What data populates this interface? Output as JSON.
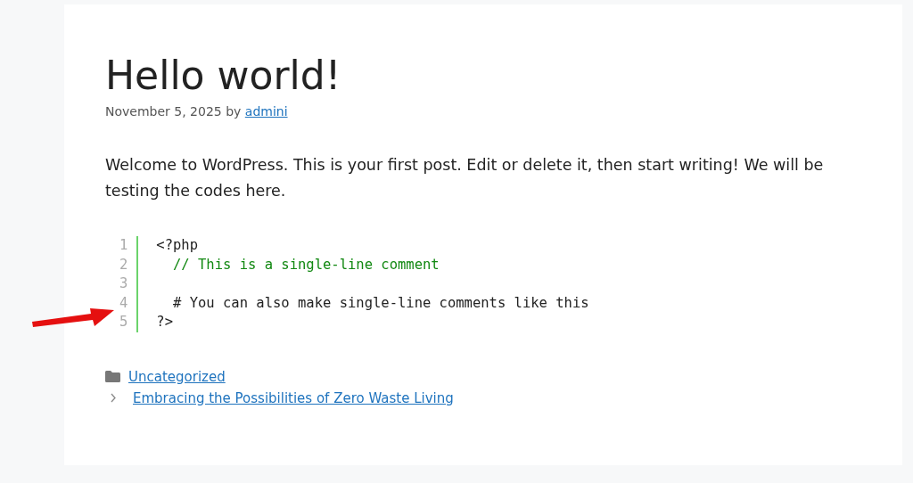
{
  "post": {
    "title": "Hello world!",
    "meta": {
      "date": "November 5, 2025",
      "by": "by",
      "author": "admini"
    },
    "body": "Welcome to WordPress. This is your first post. Edit or delete it, then start writing! We will be testing the codes here.",
    "code": [
      {
        "number": "1",
        "kind": "code",
        "text": "<?php"
      },
      {
        "number": "2",
        "kind": "comment",
        "text": "  // This is a single-line comment"
      },
      {
        "number": "3",
        "kind": "blank"
      },
      {
        "number": "4",
        "kind": "code",
        "text": "  # You can also make single-line comments like this"
      },
      {
        "number": "5",
        "kind": "code",
        "text": "?>"
      }
    ],
    "category": "Uncategorized",
    "next_post": "Embracing the Possibilities of Zero Waste Living"
  }
}
